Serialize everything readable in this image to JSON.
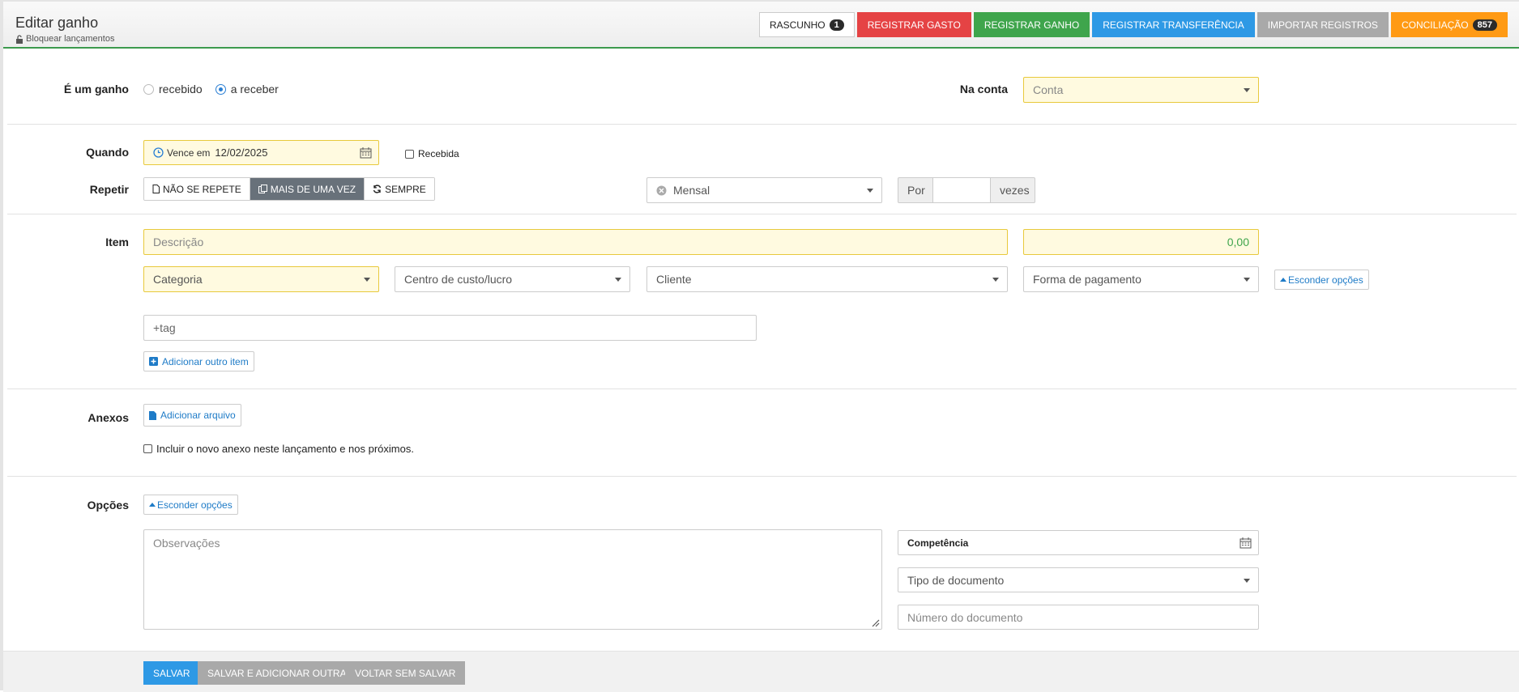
{
  "header": {
    "title": "Editar ganho",
    "lock_label": "Bloquear lançamentos",
    "buttons": {
      "draft": "RASCUNHO",
      "draft_count": "1",
      "register_expense": "REGISTRAR GASTO",
      "register_income": "REGISTRAR GANHO",
      "register_transfer": "REGISTRAR TRANSFERÊNCIA",
      "import_records": "IMPORTAR REGISTROS",
      "reconciliation": "CONCILIAÇÃO",
      "reconciliation_count": "857"
    }
  },
  "form": {
    "is_income_label": "É um ganho",
    "status_received": "recebido",
    "status_to_receive": "a receber",
    "account_label": "Na conta",
    "account_placeholder": "Conta",
    "when_label": "Quando",
    "due_prefix": "Vence em",
    "due_date": "12/02/2025",
    "received_label": "Recebida",
    "repeat_label": "Repetir",
    "repeat_options": [
      "NÃO SE REPETE",
      "MAIS DE UMA VEZ",
      "SEMPRE"
    ],
    "frequency": "Mensal",
    "por_label": "Por",
    "vezes_label": "vezes",
    "item_label": "Item",
    "description_placeholder": "Descrição",
    "amount": "0,00",
    "category_placeholder": "Categoria",
    "cost_center_placeholder": "Centro de custo/lucro",
    "client_placeholder": "Cliente",
    "payment_placeholder": "Forma de pagamento",
    "hide_options": "Esconder opções",
    "tag_placeholder": "+tag",
    "add_item": "Adicionar outro item",
    "attachments_label": "Anexos",
    "add_file": "Adicionar arquivo",
    "include_attachment": "Incluir o novo anexo neste lançamento e nos próximos.",
    "options_label": "Opções",
    "options_hide": "Esconder opções",
    "notes_placeholder": "Observações",
    "competence_label": "Competência",
    "doc_type_placeholder": "Tipo de documento",
    "doc_number_placeholder": "Número do documento"
  },
  "footer": {
    "save": "SALVAR",
    "save_add": "SALVAR E ADICIONAR OUTRA",
    "back": "VOLTAR SEM SALVAR"
  },
  "colors": {
    "header_accent": "#3c9a4d",
    "required_bg": "#fffae0",
    "link": "#1e7bc7",
    "save": "#2e99e5"
  }
}
